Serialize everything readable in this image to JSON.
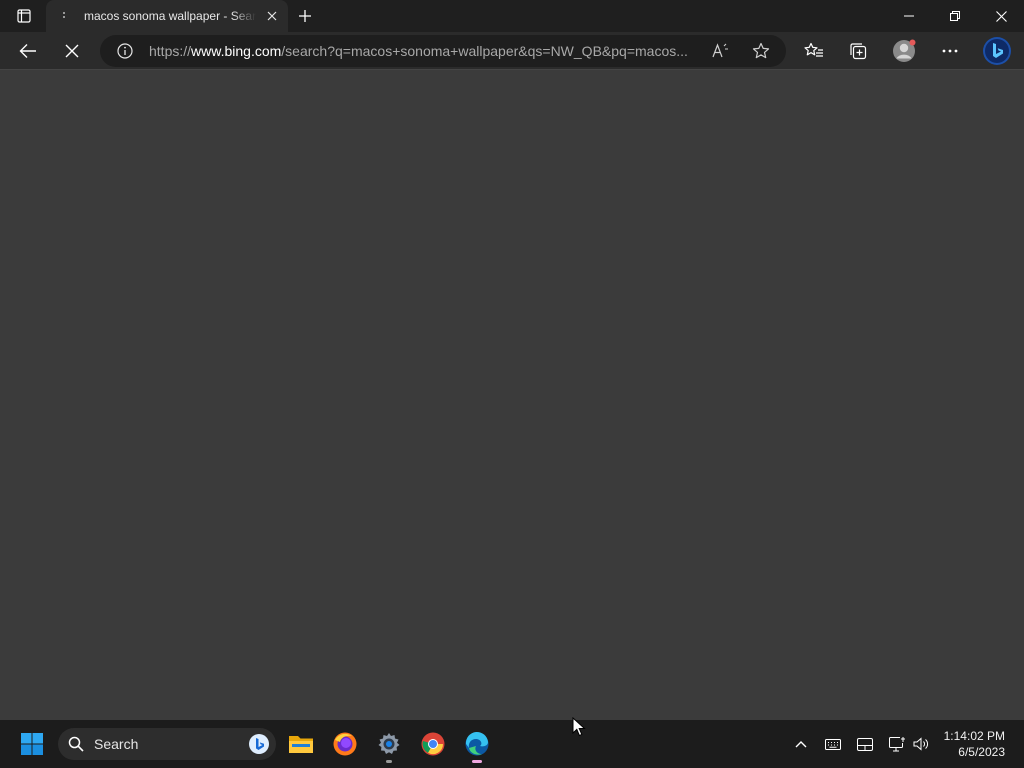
{
  "browser": {
    "tab": {
      "favicon": "loading-dots-icon",
      "title": "macos sonoma wallpaper - Search"
    },
    "address": {
      "protocol": "https://",
      "host": "www.bing.com",
      "path": "/search?q=macos+sonoma+wallpaper&qs=NW_QB&pq=macos..."
    },
    "icons": {
      "tab_actions": "tab-actions-icon",
      "new_tab": "plus-icon",
      "back": "back-arrow-icon",
      "stop": "stop-loading-icon",
      "info": "site-info-icon",
      "read_aloud": "read-aloud-icon",
      "favorite": "star-icon",
      "favorites": "favorites-list-icon",
      "collections": "collections-icon",
      "profile": "profile-avatar-icon",
      "more": "more-options-icon",
      "copilot": "bing-chat-icon"
    }
  },
  "taskbar": {
    "search_label": "Search",
    "apps": [
      "start-icon",
      "file-explorer-icon",
      "firefox-icon",
      "settings-icon",
      "chrome-icon",
      "edge-icon"
    ],
    "tray_icons": [
      "chevron-up-icon",
      "keyboard-icon",
      "display-icon",
      "network-icon",
      "volume-icon"
    ],
    "time": "1:14:02 PM",
    "date": "6/5/2023"
  },
  "colors": {
    "page_background": "#3b3b3b",
    "tab_strip": "#1f1f1f",
    "toolbar": "#2b2b2b",
    "taskbar": "#1c1c1c",
    "accent_blue": "#0078d4"
  }
}
